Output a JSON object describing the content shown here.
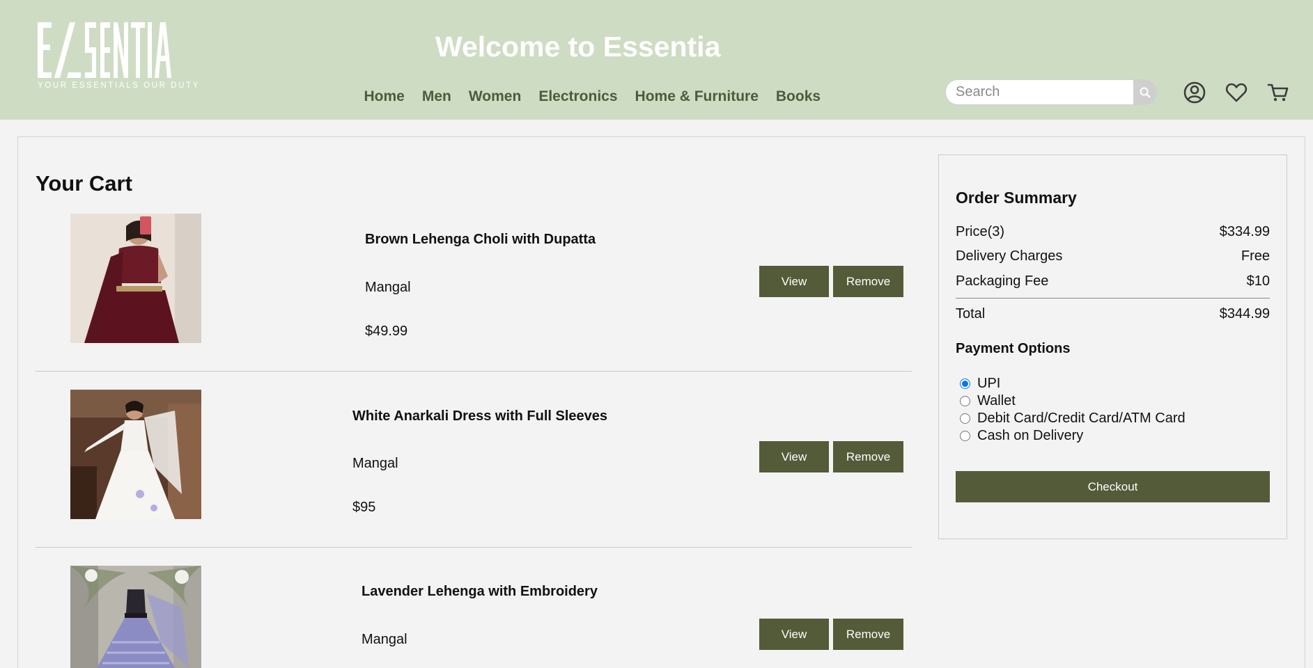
{
  "header": {
    "logo_text": "ESSENTIA",
    "logo_tagline": "YOUR ESSENTIALS OUR DUTY",
    "welcome": "Welcome to Essentia",
    "nav": [
      "Home",
      "Men",
      "Women",
      "Electronics",
      "Home & Furniture",
      "Books"
    ],
    "search_placeholder": "Search",
    "icons": [
      "search-icon",
      "user-icon",
      "heart-icon",
      "cart-icon"
    ]
  },
  "cart": {
    "title": "Your Cart",
    "items": [
      {
        "name": "Brown Lehenga Choli with Dupatta",
        "brand": "Mangal",
        "price": "$49.99",
        "view_label": "View",
        "remove_label": "Remove"
      },
      {
        "name": "White Anarkali Dress with Full Sleeves",
        "brand": "Mangal",
        "price": "$95",
        "view_label": "View",
        "remove_label": "Remove"
      },
      {
        "name": "Lavender Lehenga with Embroidery",
        "brand": "Mangal",
        "price": "",
        "view_label": "View",
        "remove_label": "Remove"
      }
    ]
  },
  "summary": {
    "title": "Order Summary",
    "rows": [
      {
        "label": "Price(3)",
        "value": "$334.99"
      },
      {
        "label": "Delivery Charges",
        "value": "Free"
      },
      {
        "label": "Packaging Fee",
        "value": "$10"
      },
      {
        "label": "Total",
        "value": "$344.99"
      }
    ],
    "payment_title": "Payment Options",
    "payment_options": [
      "UPI",
      "Wallet",
      "Debit Card/Credit Card/ATM Card",
      "Cash on Delivery"
    ],
    "selected_payment": "UPI",
    "checkout_label": "Checkout"
  },
  "colors": {
    "header_bg": "#cfdcc4",
    "nav_text": "#4f5a3a",
    "button_bg": "#535b38",
    "page_bg": "#f3f3f3"
  }
}
